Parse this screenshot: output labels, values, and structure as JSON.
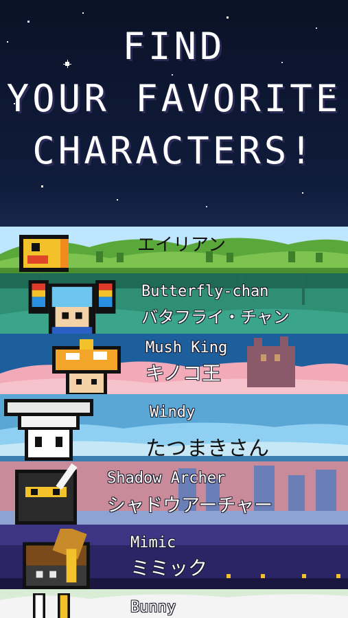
{
  "headline": {
    "line1": "FIND",
    "line2": "YOUR FAVORITE",
    "line3": "CHARACTERS!"
  },
  "characters": [
    {
      "en": "",
      "jp": "エイリアン",
      "bg": "#7ec24f",
      "sky": "#bfe6ff"
    },
    {
      "en": "Butterfly-chan",
      "jp": "バタフライ・チャン",
      "bg": "#2b7f6a",
      "sky": "#3aa58a"
    },
    {
      "en": "Mush King",
      "jp": "キノコ王",
      "bg": "#1d5f9c",
      "sky": "#f2a9b8"
    },
    {
      "en": "Windy",
      "jp": "たつまきさん",
      "bg": "#5aa7d6",
      "sky": "#8fd0f2"
    },
    {
      "en": "Shadow Archer",
      "jp": "シャドウアーチャー",
      "bg": "#c98a9a",
      "sky": "#6a7fb8"
    },
    {
      "en": "Mimic",
      "jp": "ミミック",
      "bg": "#2b2566",
      "sky": "#3f3585"
    },
    {
      "en": "Bunny",
      "jp": "",
      "bg": "#d8ecd6",
      "sky": "#f4f4f4"
    }
  ]
}
